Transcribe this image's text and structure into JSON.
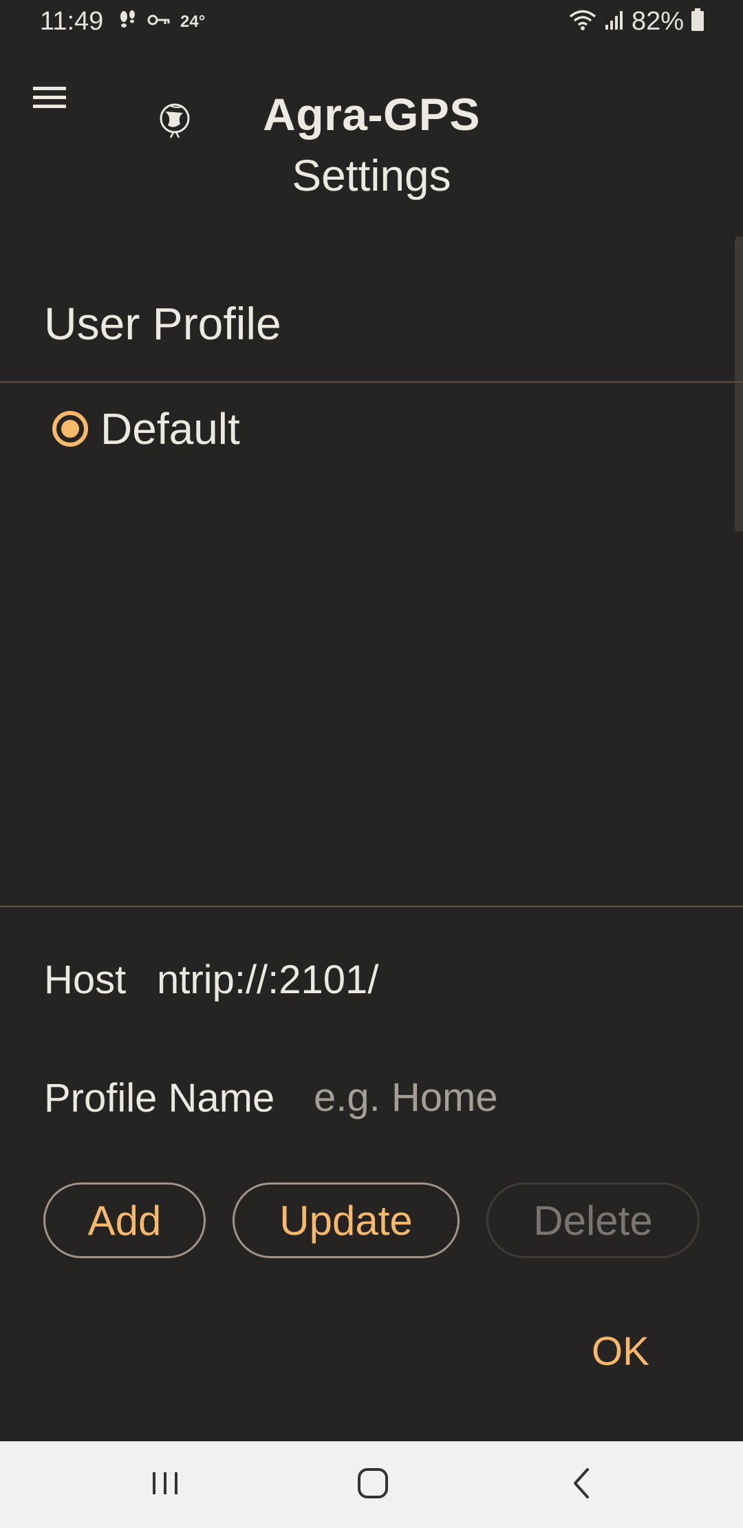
{
  "status_bar": {
    "time": "11:49",
    "temperature": "24°",
    "battery": "82%"
  },
  "header": {
    "title": "Agra-GPS",
    "subtitle": "Settings",
    "menu_icon": "hamburger-menu-icon",
    "logo_icon": "globe-logo-icon"
  },
  "profile_section": {
    "title": "User Profile",
    "profiles": [
      {
        "label": "Default",
        "selected": true
      }
    ]
  },
  "form": {
    "host_label": "Host",
    "host_value": "ntrip://:2101/",
    "profile_name_label": "Profile Name",
    "profile_name_placeholder": "e.g. Home",
    "profile_name_value": ""
  },
  "buttons": {
    "add": "Add",
    "update": "Update",
    "delete": "Delete",
    "ok": "OK"
  },
  "colors": {
    "background": "#252422",
    "accent": "#f6b86a",
    "text": "#ece8e2",
    "divider": "#5d5246",
    "disabled": "#7a7570"
  }
}
